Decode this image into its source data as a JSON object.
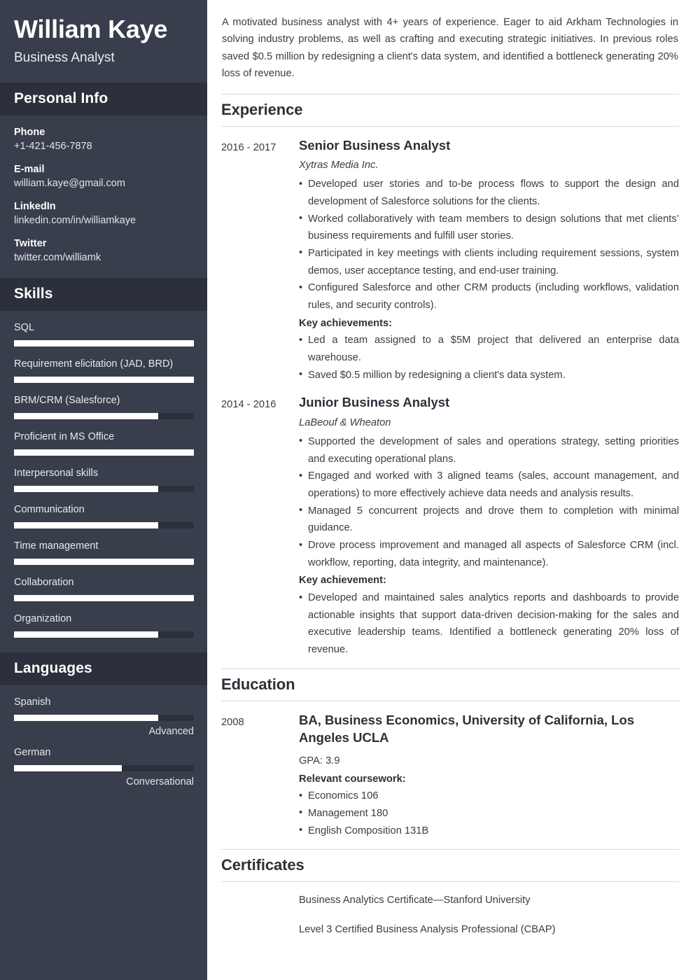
{
  "colors": {
    "sidebar_bg": "#383e4c",
    "sidebar_band_bg": "#2b303c",
    "bar_fill": "#ffffff",
    "text_dark": "#2c3038",
    "rule": "#d8dade"
  },
  "sidebar": {
    "full_name": "William Kaye",
    "job_title": "Business Analyst",
    "personal_info": {
      "heading": "Personal Info",
      "items": [
        {
          "label": "Phone",
          "value": "+1-421-456-7878"
        },
        {
          "label": "E-mail",
          "value": "william.kaye@gmail.com"
        },
        {
          "label": "LinkedIn",
          "value": "linkedin.com/in/williamkaye"
        },
        {
          "label": "Twitter",
          "value": "twitter.com/williamk"
        }
      ]
    },
    "skills": {
      "heading": "Skills",
      "items": [
        {
          "name": "SQL",
          "level": 100
        },
        {
          "name": "Requirement elicitation (JAD, BRD)",
          "level": 100
        },
        {
          "name": "BRM/CRM (Salesforce)",
          "level": 80
        },
        {
          "name": "Proficient in MS Office",
          "level": 100
        },
        {
          "name": "Interpersonal skills",
          "level": 80
        },
        {
          "name": "Communication",
          "level": 80
        },
        {
          "name": "Time management",
          "level": 100
        },
        {
          "name": "Collaboration",
          "level": 100
        },
        {
          "name": "Organization",
          "level": 80
        }
      ]
    },
    "languages": {
      "heading": "Languages",
      "items": [
        {
          "name": "Spanish",
          "level": 80,
          "proficiency": "Advanced"
        },
        {
          "name": "German",
          "level": 60,
          "proficiency": "Conversational"
        }
      ]
    }
  },
  "main": {
    "summary": "A motivated business analyst with 4+ years of experience. Eager to aid Arkham Technologies in solving industry problems, as well as crafting and executing strategic initiatives. In previous roles saved $0.5 million by redesigning a client's data system, and identified a bottleneck generating 20% loss of revenue.",
    "experience": {
      "heading": "Experience",
      "entries": [
        {
          "date": "2016 - 2017",
          "title": "Senior Business Analyst",
          "org": "Xytras Media Inc.",
          "bullets": [
            "Developed user stories and to-be process flows to support the design and development of Salesforce solutions for the clients.",
            "Worked collaboratively with team members to design solutions that met clients’ business requirements and fulfill user stories.",
            "Participated in key meetings with clients including requirement sessions, system demos, user acceptance testing, and end-user training.",
            "Configured Salesforce and other CRM products (including workflows, validation rules, and security controls)."
          ],
          "achievements_label": "Key achievements:",
          "achievements": [
            "Led a team assigned to a $5M project that delivered an enterprise data warehouse.",
            "Saved $0.5 million by redesigning a client's data system."
          ]
        },
        {
          "date": "2014 - 2016",
          "title": "Junior Business Analyst",
          "org": "LaBeouf & Wheaton",
          "bullets": [
            "Supported the development of sales and operations strategy, setting priorities and executing operational plans.",
            "Engaged and worked with 3 aligned teams (sales, account management, and operations) to more effectively achieve data needs and analysis results.",
            "Managed 5 concurrent projects and drove them to completion with minimal guidance.",
            "Drove process improvement and managed all aspects of Salesforce CRM (incl. workflow, reporting, data integrity, and maintenance)."
          ],
          "achievements_label": "Key achievement:",
          "achievements": [
            "Developed and maintained sales analytics reports and dashboards to provide actionable insights that support data-driven decision-making for the sales and executive leadership teams. Identified a bottleneck generating 20% loss of revenue."
          ]
        }
      ]
    },
    "education": {
      "heading": "Education",
      "entries": [
        {
          "date": "2008",
          "title": "BA, Business Economics, University of California, Los Angeles UCLA",
          "gpa": "GPA: 3.9",
          "coursework_label": "Relevant coursework:",
          "coursework": [
            "Economics 106",
            "Management 180",
            "English Composition 131B"
          ]
        }
      ]
    },
    "certificates": {
      "heading": "Certificates",
      "items": [
        "Business Analytics Certificate—Stanford University",
        "Level 3 Certified Business Analysis Professional (CBAP)"
      ]
    }
  }
}
